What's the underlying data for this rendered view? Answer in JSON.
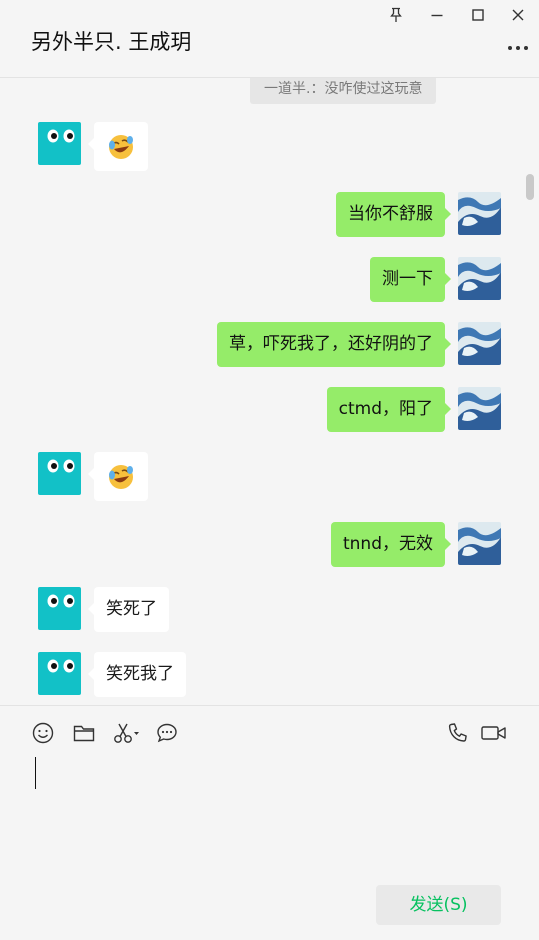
{
  "window": {
    "title": "另外半只. 王成玥"
  },
  "chat": {
    "system_notice": "一道半.：没咋使过这玩意",
    "messages": [
      {
        "side": "left",
        "type": "emoji",
        "emoji": "laughing-rolling-emoji"
      },
      {
        "side": "right",
        "type": "text",
        "text": "当你不舒服"
      },
      {
        "side": "right",
        "type": "text",
        "text": "测一下"
      },
      {
        "side": "right",
        "type": "text",
        "text": "草，吓死我了，还好阴的了"
      },
      {
        "side": "right",
        "type": "text",
        "text": "ctmd，阳了"
      },
      {
        "side": "left",
        "type": "emoji",
        "emoji": "laughing-rolling-emoji"
      },
      {
        "side": "right",
        "type": "text",
        "text": "tnnd，无效"
      },
      {
        "side": "left",
        "type": "text",
        "text": "笑死了"
      },
      {
        "side": "left",
        "type": "text",
        "text": "笑死我了"
      }
    ]
  },
  "toolbar": {
    "icons": [
      "smiley-icon",
      "folder-icon",
      "scissors-icon",
      "chat-bubble-icon",
      "phone-icon",
      "video-icon"
    ]
  },
  "composer": {
    "value": "",
    "send_label": "发送(S)"
  },
  "colors": {
    "self_bubble": "#95ec69",
    "other_bubble": "#ffffff",
    "send_text": "#07c160",
    "avatar_teal": "#12c1c7"
  }
}
